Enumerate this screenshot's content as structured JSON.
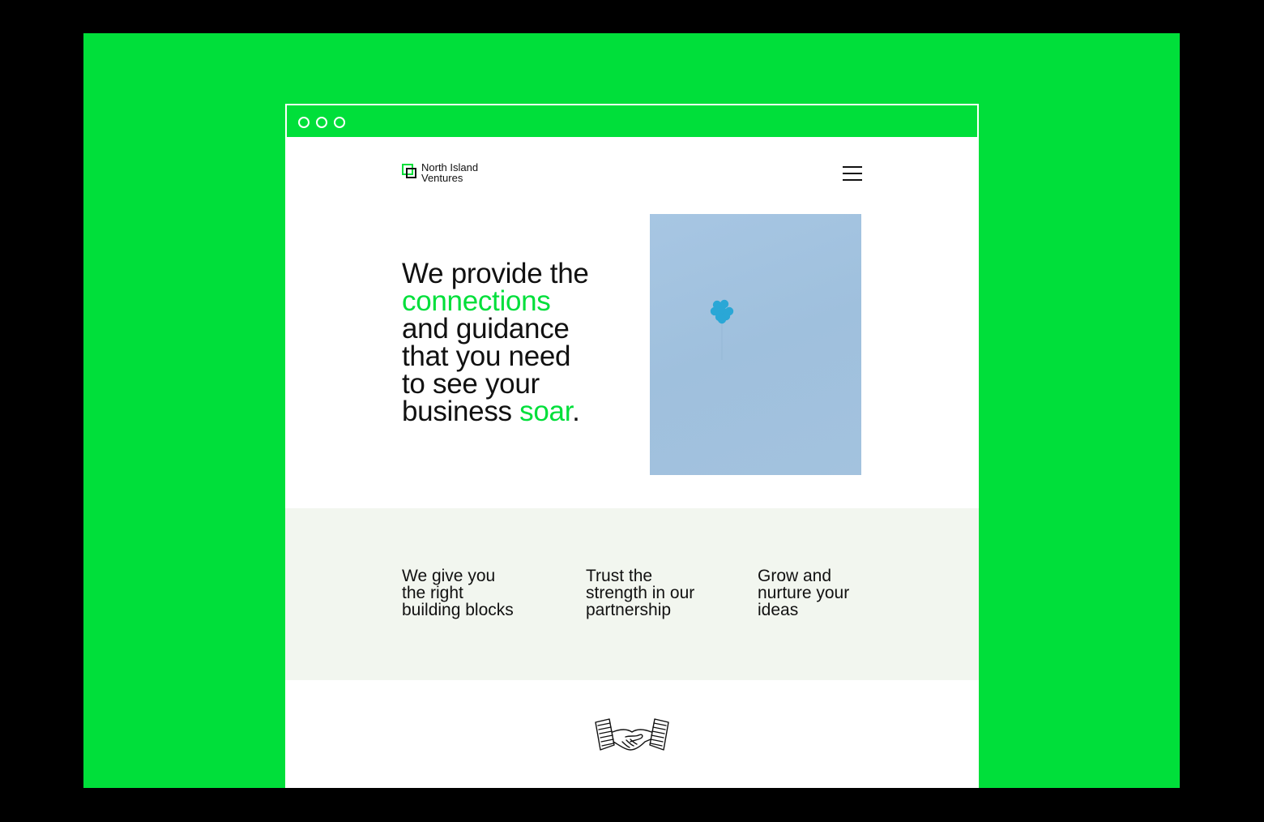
{
  "logo": {
    "line1": "North Island",
    "line2": "Ventures"
  },
  "hero": {
    "lines": [
      {
        "parts": [
          {
            "text": "We provide the",
            "accent": false
          }
        ]
      },
      {
        "parts": [
          {
            "text": "connections",
            "accent": true
          }
        ]
      },
      {
        "parts": [
          {
            "text": "and guidance",
            "accent": false
          }
        ]
      },
      {
        "parts": [
          {
            "text": "that you need",
            "accent": false
          }
        ]
      },
      {
        "parts": [
          {
            "text": "to see your",
            "accent": false
          }
        ]
      },
      {
        "parts": [
          {
            "text": "business ",
            "accent": false
          },
          {
            "text": "soar",
            "accent": true
          },
          {
            "text": ".",
            "accent": false
          }
        ]
      }
    ]
  },
  "features": [
    {
      "lines": [
        "We give you",
        "the right",
        "building blocks"
      ]
    },
    {
      "lines": [
        "Trust the",
        "strength in our",
        "partnership"
      ]
    },
    {
      "lines": [
        "Grow and",
        "nurture your",
        "ideas"
      ]
    }
  ],
  "colors": {
    "accent": "#00DF3A",
    "band": "#F2F6EF",
    "sky": "#A3C2DE",
    "balloon": "#2AA7D6"
  },
  "icons": {
    "menu": "hamburger-menu-icon",
    "illustration": "handshake-illustration"
  }
}
